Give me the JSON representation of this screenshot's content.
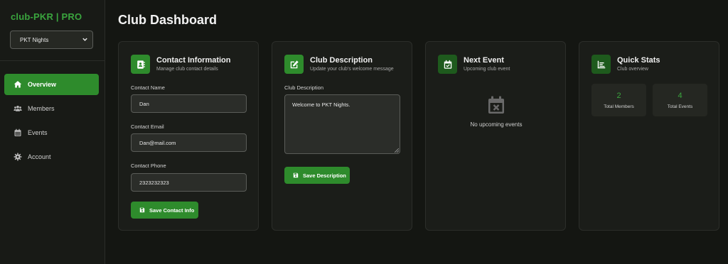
{
  "brand": "club-PKR | PRO",
  "club_selector": {
    "value": "PKT Nights"
  },
  "nav": [
    {
      "label": "Overview",
      "icon": "home-icon",
      "active": true
    },
    {
      "label": "Members",
      "icon": "users-icon",
      "active": false
    },
    {
      "label": "Events",
      "icon": "calendar-icon",
      "active": false
    },
    {
      "label": "Account",
      "icon": "gear-icon",
      "active": false
    }
  ],
  "page_title": "Club Dashboard",
  "contact_card": {
    "title": "Contact Information",
    "subtitle": "Manage club contact details",
    "name_label": "Contact Name",
    "name_value": "Dan",
    "email_label": "Contact Email",
    "email_value": "Dan@mail.com",
    "phone_label": "Contact Phone",
    "phone_value": "2323232323",
    "save_label": "Save Contact Info"
  },
  "description_card": {
    "title": "Club Description",
    "subtitle": "Update your club's welcome message",
    "field_label": "Club Description",
    "field_value": "Welcome to PKT Nights.",
    "save_label": "Save Description"
  },
  "event_card": {
    "title": "Next Event",
    "subtitle": "Upcoming club event",
    "empty_text": "No upcoming events"
  },
  "stats_card": {
    "title": "Quick Stats",
    "subtitle": "Club overview",
    "stats": [
      {
        "value": "2",
        "label": "Total Members"
      },
      {
        "value": "4",
        "label": "Total Events"
      }
    ]
  },
  "colors": {
    "accent": "#2e8b2c",
    "brand_text": "#3aa53e",
    "background": "#141612",
    "card": "#1b1d19"
  }
}
